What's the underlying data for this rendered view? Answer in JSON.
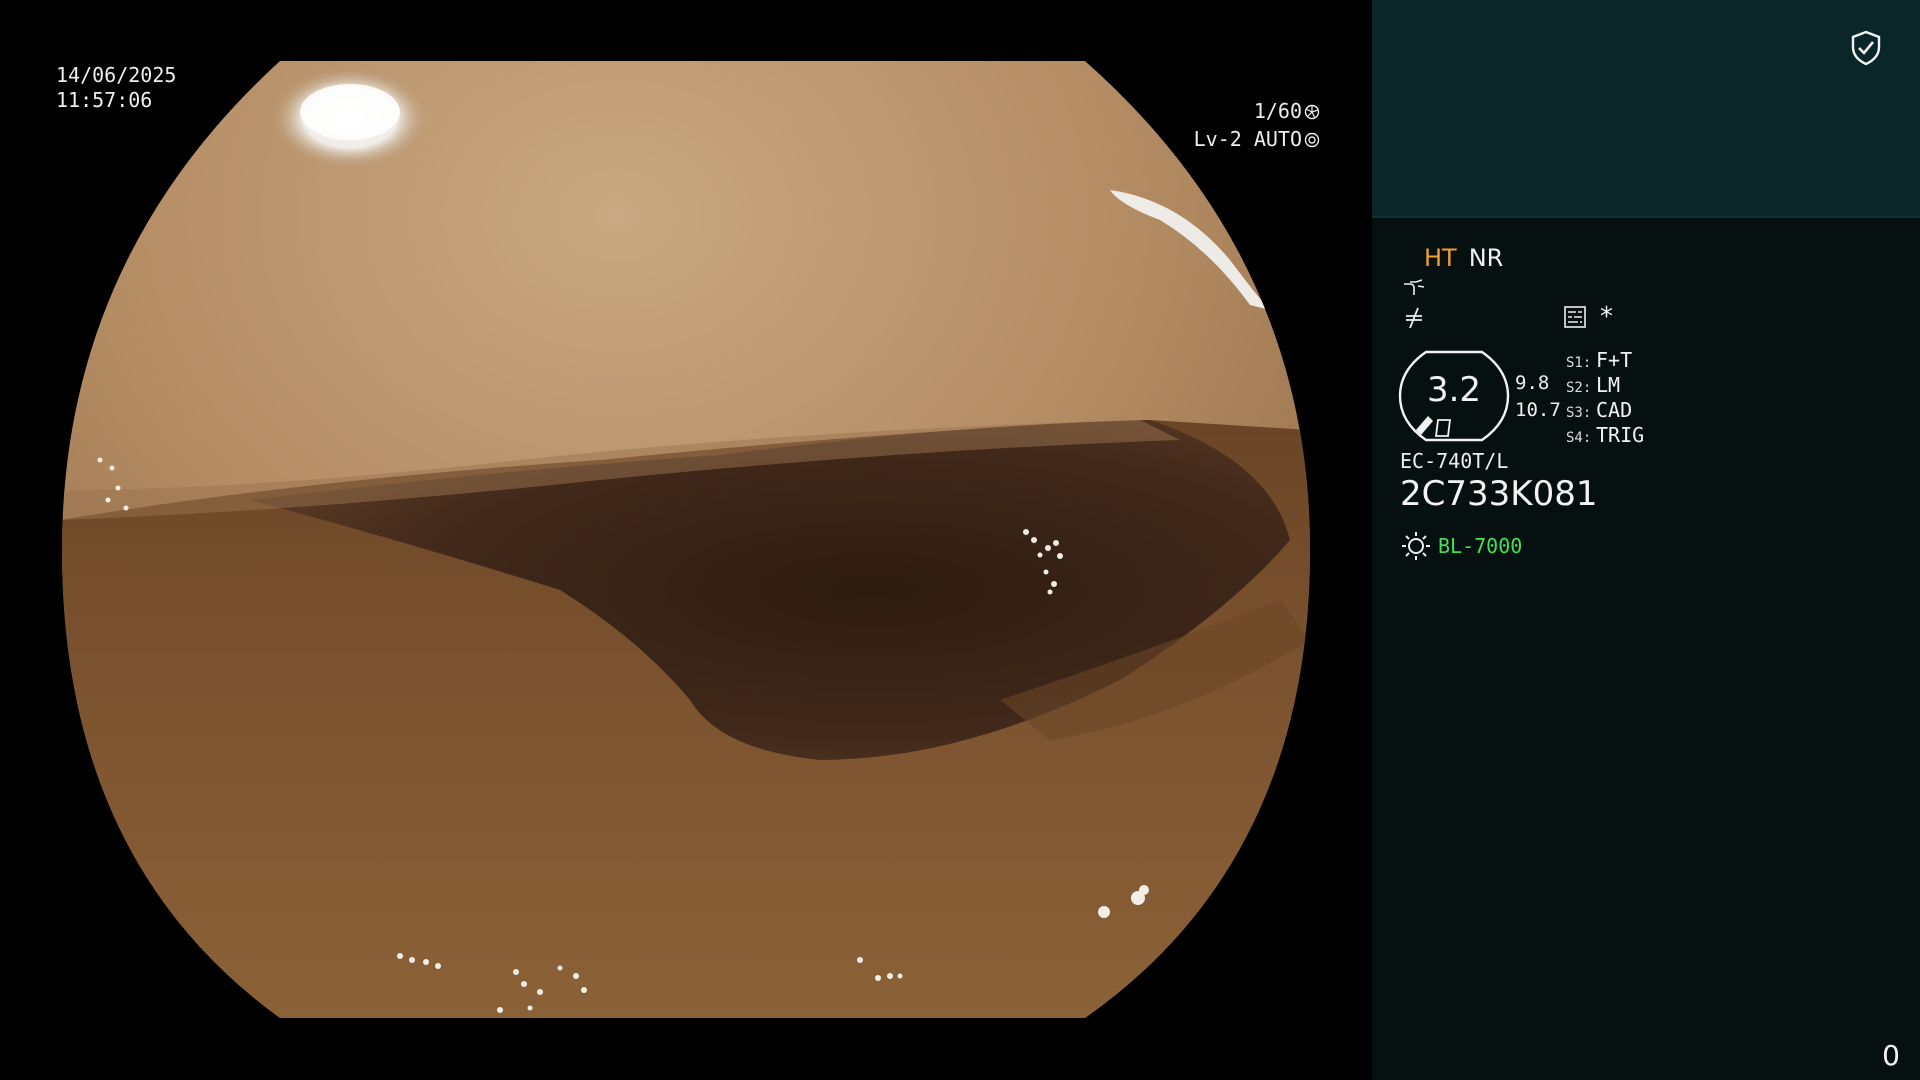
{
  "overlay": {
    "date": "14/06/2025",
    "time": "11:57:06",
    "shutter": "1/60",
    "level": "Lv-2 AUTO"
  },
  "panel": {
    "ht": "HT",
    "nr": "NR",
    "asterisk": "*",
    "zoom_main": "3.2",
    "zoom_a": "9.8",
    "zoom_b": "10.7",
    "switches": [
      {
        "key": "S1:",
        "value": "F+T"
      },
      {
        "key": "S2:",
        "value": "LM"
      },
      {
        "key": "S3:",
        "value": "CAD"
      },
      {
        "key": "S4:",
        "value": "TRIG"
      }
    ],
    "scope_model": "EC-740T/L",
    "scope_serial": "2C733K081",
    "light_source": "BL-7000",
    "counter": "0"
  },
  "colors": {
    "ht": "#f0a030",
    "light_source": "#44dd55",
    "panel_top": "#0b2628",
    "panel_bg": "#071010"
  },
  "icons": [
    "shutter-icon",
    "iris-icon",
    "shield-check-icon",
    "enhancement-icon",
    "color-tone-icon",
    "settings-icon",
    "zoom-badge-icon",
    "light-source-icon"
  ]
}
